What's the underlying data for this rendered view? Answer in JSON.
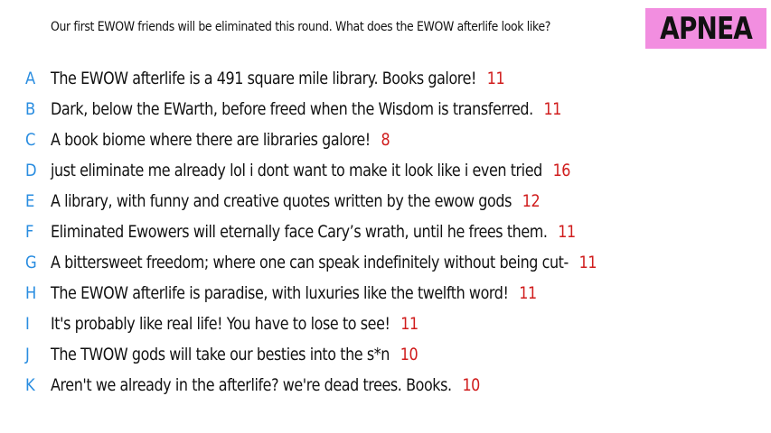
{
  "prompt": "Our first EWOW friends will be eliminated this round. What does the EWOW afterlife look like?",
  "title": "APNEA",
  "colors": {
    "title_background": "#f28ee0",
    "letter": "#2a8de0",
    "count": "#d01c1c",
    "text": "#111111"
  },
  "responses": [
    {
      "letter": "A",
      "text": "The EWOW afterlife is a 491 square mile library. Books galore!",
      "count": "11"
    },
    {
      "letter": "B",
      "text": "Dark, below the EWarth, before freed when the Wisdom is transferred.",
      "count": "11"
    },
    {
      "letter": "C",
      "text": "A book biome where there are libraries galore!",
      "count": "8"
    },
    {
      "letter": "D",
      "text": "just eliminate me already lol i dont want to make it look like i even tried",
      "count": "16"
    },
    {
      "letter": "E",
      "text": "A library, with funny and creative quotes written by the ewow gods",
      "count": "12"
    },
    {
      "letter": "F",
      "text": "Eliminated Ewowers will eternally face Cary’s wrath, until he frees them.",
      "count": "11"
    },
    {
      "letter": "G",
      "text": "A bittersweet freedom; where one can speak indefinitely without being cut-",
      "count": "11"
    },
    {
      "letter": "H",
      "text": "The EWOW afterlife is paradise, with luxuries like the twelfth word!",
      "count": "11"
    },
    {
      "letter": "I",
      "text": "It's probably like real life! You have to lose to see!",
      "count": "11"
    },
    {
      "letter": "J",
      "text": "The TWOW gods will take our besties into the s*n",
      "count": "10"
    },
    {
      "letter": "K",
      "text": "Aren't we already in the afterlife? we're dead trees. Books.",
      "count": "10"
    }
  ]
}
